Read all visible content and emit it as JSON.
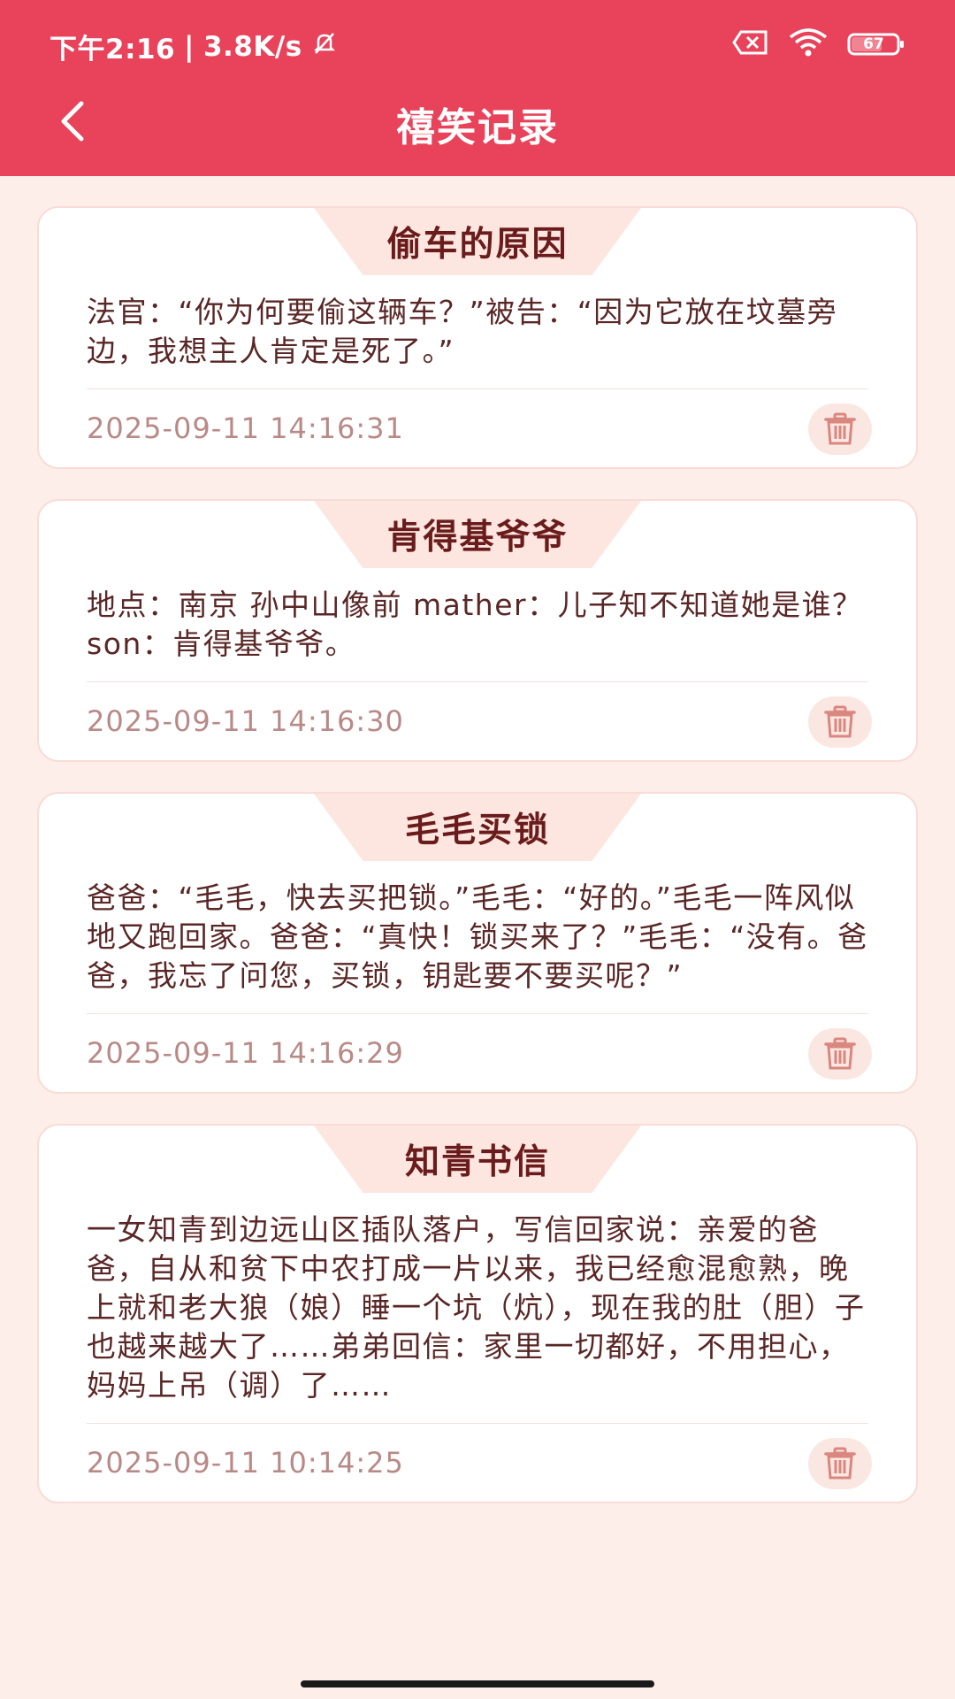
{
  "status_bar": {
    "time": "下午2:16",
    "speed": "3.8K/s",
    "battery": "67"
  },
  "header": {
    "title": "禧笑记录"
  },
  "colors": {
    "header_bg": "#e8435a",
    "page_bg": "#fdeeea",
    "title_tab_bg": "#fde6df",
    "title_text": "#6a1c1c",
    "body_text": "#5a2626",
    "timestamp_text": "#b88a87",
    "delete_icon": "#d9877f"
  },
  "records": [
    {
      "title": "偷车的原因",
      "content": "法官：“你为何要偷这辆车？”被告：“因为它放在坟墓旁边，我想主人肯定是死了。”",
      "time": "2025-09-11 14:16:31"
    },
    {
      "title": "肯得基爷爷",
      "content": "地点：南京 孙中山像前 mather：儿子知不知道她是谁？ son：肯得基爷爷。",
      "time": "2025-09-11 14:16:30"
    },
    {
      "title": "毛毛买锁",
      "content": "爸爸：“毛毛，快去买把锁。”毛毛：“好的。”毛毛一阵风似地又跑回家。爸爸：“真快！锁买来了？”毛毛：“没有。爸爸，我忘了问您，买锁，钥匙要不要买呢？”",
      "time": "2025-09-11 14:16:29"
    },
    {
      "title": "知青书信",
      "content": "一女知青到边远山区插队落户，写信回家说：亲爱的爸爸，自从和贫下中农打成一片以来，我已经愈混愈熟，晚上就和老大狼（娘）睡一个坑（炕），现在我的肚（胆）子也越来越大了……弟弟回信：家里一切都好，不用担心，妈妈上吊（调）了……",
      "time": "2025-09-11 10:14:25"
    }
  ]
}
